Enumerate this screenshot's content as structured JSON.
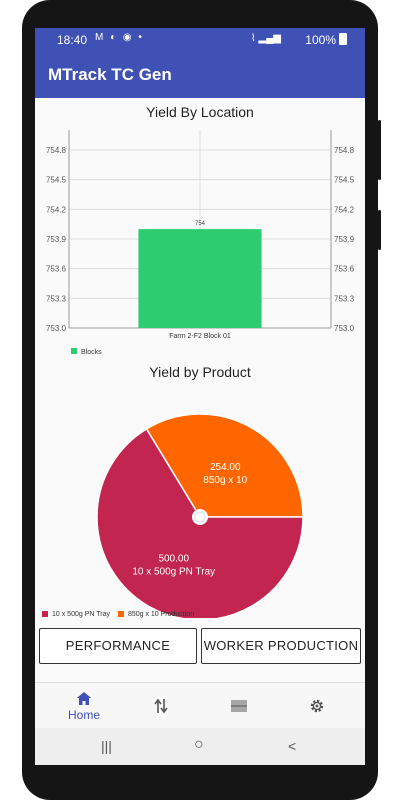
{
  "status_bar": {
    "time": "18:40",
    "notification_icons": "M ◐ ◉ •",
    "signal": "⌇ ▂▄▆",
    "battery": "100%"
  },
  "app_bar": {
    "title": "MTrack TC Gen"
  },
  "yield_by_location": {
    "title": "Yield By Location",
    "chart_data": {
      "type": "bar",
      "categories": [
        "Farm 2-F2 Block 01"
      ],
      "series": [
        {
          "name": "Blocks",
          "values": [
            754
          ]
        }
      ],
      "y_ticks": [
        "754.8",
        "754.5",
        "754.2",
        "753.9",
        "753.6",
        "753.3",
        "753.0"
      ],
      "ylim": [
        753.0,
        754.8
      ],
      "data_labels": [
        "754"
      ],
      "legend_position": "bottom-left",
      "color": "#2ecc71",
      "grid": true
    }
  },
  "yield_by_product": {
    "title": "Yield by Product",
    "chart_data": {
      "type": "pie",
      "slices": [
        {
          "label": "10 x 500g PN Tray",
          "value": 500.0,
          "value_text": "500.00",
          "color": "#c2254f"
        },
        {
          "label": "850g x 10",
          "value": 254.0,
          "value_text": "254.00",
          "color": "#ff6600"
        }
      ],
      "legend": [
        "10 x 500g PN Tray",
        "850g x 10  Production"
      ],
      "legend_position": "bottom-left"
    }
  },
  "buttons": {
    "performance": "PERFORMANCE",
    "worker_production": "WORKER PRODUCTION"
  },
  "bottom_nav": {
    "items": [
      {
        "label": "Home",
        "icon": "home-icon",
        "active": true
      },
      {
        "label": "",
        "icon": "transfer-arrows-icon"
      },
      {
        "label": "",
        "icon": "barcode-icon"
      },
      {
        "label": "",
        "icon": "gear-icon"
      }
    ],
    "accent": "#3f51b5"
  },
  "system_nav": {
    "recents": "|||",
    "home": "○",
    "back": "<"
  }
}
